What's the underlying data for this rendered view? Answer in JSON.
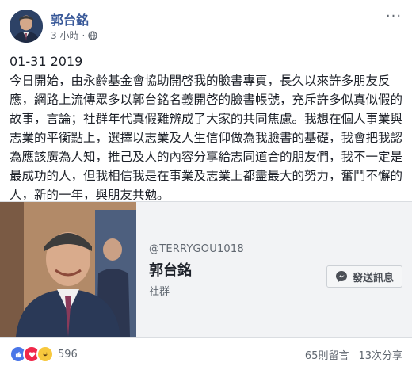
{
  "post": {
    "author_name": "郭台銘",
    "timestamp": "3 小時",
    "audience_icon": "globe-icon",
    "date_line": "01-31 2019",
    "text": "今日開始，由永齡基金會協助開啓我的臉書專頁，長久以來許多朋友反應，網路上流傳眾多以郭台銘名義開啓的臉書帳號，充斥許多似真似假的故事，言論；社群年代真假難辨成了大家的共同焦慮。我想在個人事業與志業的平衡點上，選擇以志業及人生信仰做為我臉書的基礎，我會把我認為應該廣為人知，推己及人的內容分享給志同道合的朋友們，我不一定是最成功的人，但我相信我是在事業及志業上都盡最大的努力，奮鬥不懈的人，新的一年，與朋友共勉。"
  },
  "card": {
    "handle": "@TERRYGOU1018",
    "page_name": "郭台銘",
    "category": "社群",
    "message_button_label": "發送訊息"
  },
  "footer": {
    "reaction_count": "596",
    "comments_label": "65則留言",
    "shares_label": "13次分享"
  },
  "colors": {
    "link_blue": "#385898",
    "like_blue": "#4a76e8",
    "love_red": "#f0284a",
    "haha_yellow": "#f7c83d"
  }
}
